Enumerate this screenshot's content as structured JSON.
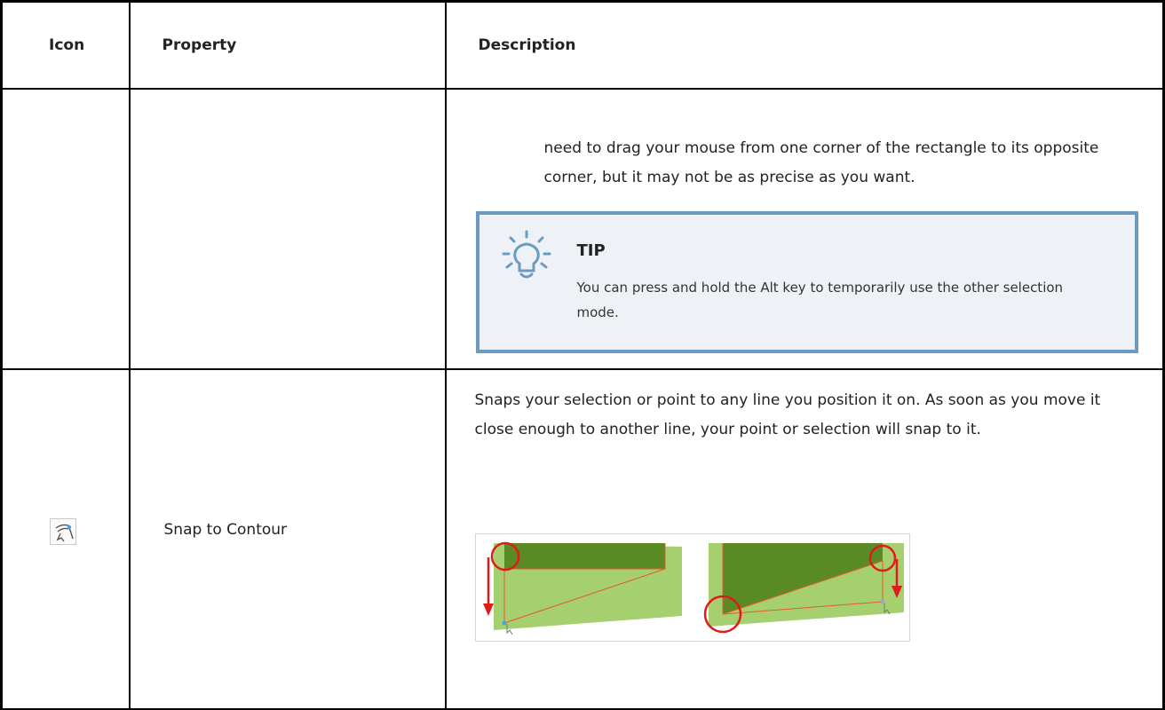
{
  "table": {
    "headers": {
      "icon": "Icon",
      "property": "Property",
      "description": "Description"
    }
  },
  "row1": {
    "continued_text": "need to drag your mouse from one corner of the rectangle to its opposite corner, but it may not be as precise as you want.",
    "tip": {
      "title": "TIP",
      "icon": "lightbulb-icon",
      "body": "You can press and hold the Alt key to temporarily use the other selection mode.",
      "accent_color": "#6a9cc3",
      "background_color": "#eef2f6"
    }
  },
  "row2": {
    "icon": "snap-to-contour-icon",
    "property": "Snap to Contour",
    "description": "Snaps your selection or point to any line you position it on. As soon as you move it close enough to another line, your point or selection will snap to it.",
    "figure_colors": {
      "fill_light": "#a6d06f",
      "fill_dark": "#5a8a24",
      "marker": "#e01b1b"
    }
  }
}
